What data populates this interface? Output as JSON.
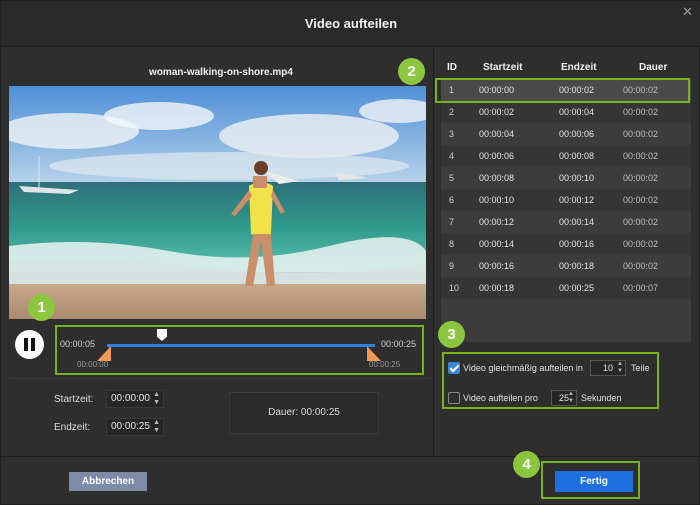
{
  "dialog": {
    "title": "Video aufteilen",
    "close_glyph": "✕"
  },
  "video": {
    "filename": "woman-walking-on-shore.mp4"
  },
  "timeline": {
    "start_label": "00:00:05",
    "end_label": "00:00:25",
    "start_sub": "00:00:00",
    "end_sub": "00:00:25"
  },
  "times": {
    "start_label": "Startzeit:",
    "start_value": "00:00:00",
    "end_label": "Endzeit:",
    "end_value": "00:00:25",
    "duration_label": "Dauer:",
    "duration_value": "00:00:25"
  },
  "table": {
    "headers": [
      "ID",
      "Startzeit",
      "Endzeit",
      "Dauer"
    ],
    "rows": [
      [
        "1",
        "00:00:00",
        "00:00:02",
        "00:00:02"
      ],
      [
        "2",
        "00:00:02",
        "00:00:04",
        "00:00:02"
      ],
      [
        "3",
        "00:00:04",
        "00:00:06",
        "00:00:02"
      ],
      [
        "4",
        "00:00:06",
        "00:00:08",
        "00:00:02"
      ],
      [
        "5",
        "00:00:08",
        "00:00:10",
        "00:00:02"
      ],
      [
        "6",
        "00:00:10",
        "00:00:12",
        "00:00:02"
      ],
      [
        "7",
        "00:00:12",
        "00:00:14",
        "00:00:02"
      ],
      [
        "8",
        "00:00:14",
        "00:00:16",
        "00:00:02"
      ],
      [
        "9",
        "00:00:16",
        "00:00:18",
        "00:00:02"
      ],
      [
        "10",
        "00:00:18",
        "00:00:25",
        "00:00:07"
      ]
    ]
  },
  "options": {
    "even_label": "Video gleichmäßig aufteilen in",
    "even_value": "10",
    "even_unit": "Teile",
    "per_label": "Video aufteilen pro",
    "per_value": "25",
    "per_unit": "Sekunden"
  },
  "buttons": {
    "cancel": "Abbrechen",
    "ok": "Fertig"
  },
  "badges": [
    "1",
    "2",
    "3",
    "4"
  ],
  "colors": {
    "highlight": "#7ab317",
    "badge": "#8cc63f",
    "primary": "#1e6fe0",
    "timeline": "#2f7fe0"
  }
}
